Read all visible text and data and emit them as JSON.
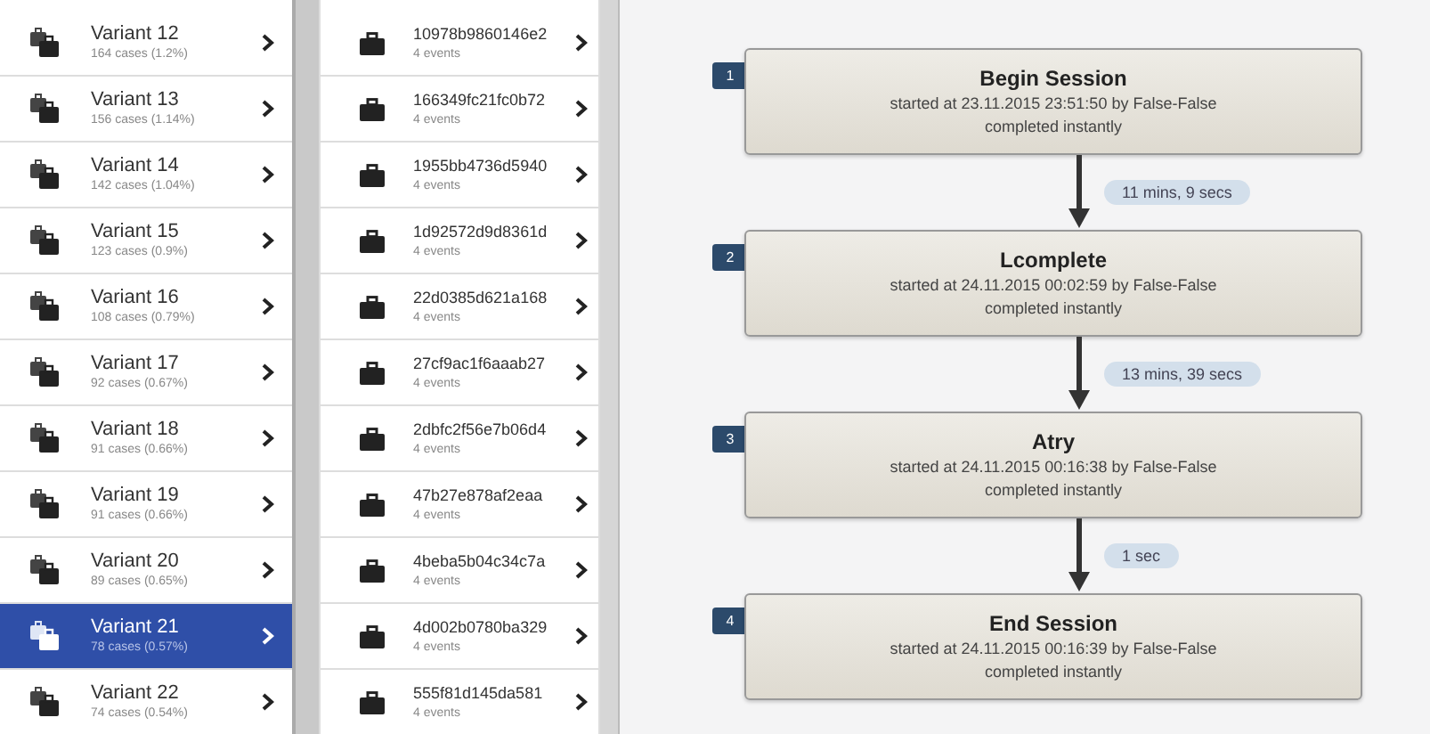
{
  "variants": [
    {
      "name": "Variant 12",
      "cases": "164 cases (1.2%)",
      "selected": false
    },
    {
      "name": "Variant 13",
      "cases": "156 cases (1.14%)",
      "selected": false
    },
    {
      "name": "Variant 14",
      "cases": "142 cases (1.04%)",
      "selected": false
    },
    {
      "name": "Variant 15",
      "cases": "123 cases (0.9%)",
      "selected": false
    },
    {
      "name": "Variant 16",
      "cases": "108 cases (0.79%)",
      "selected": false
    },
    {
      "name": "Variant 17",
      "cases": "92 cases (0.67%)",
      "selected": false
    },
    {
      "name": "Variant 18",
      "cases": "91 cases (0.66%)",
      "selected": false
    },
    {
      "name": "Variant 19",
      "cases": "91 cases (0.66%)",
      "selected": false
    },
    {
      "name": "Variant 20",
      "cases": "89 cases (0.65%)",
      "selected": false
    },
    {
      "name": "Variant 21",
      "cases": "78 cases (0.57%)",
      "selected": true
    },
    {
      "name": "Variant 22",
      "cases": "74 cases (0.54%)",
      "selected": false
    }
  ],
  "cases": [
    {
      "id": "10978b9860146e2",
      "events": "4 events"
    },
    {
      "id": "166349fc21fc0b72",
      "events": "4 events"
    },
    {
      "id": "1955bb4736d5940",
      "events": "4 events"
    },
    {
      "id": "1d92572d9d8361d",
      "events": "4 events"
    },
    {
      "id": "22d0385d621a168",
      "events": "4 events"
    },
    {
      "id": "27cf9ac1f6aaab27",
      "events": "4 events"
    },
    {
      "id": "2dbfc2f56e7b06d4",
      "events": "4 events"
    },
    {
      "id": "47b27e878af2eaa",
      "events": "4 events"
    },
    {
      "id": "4beba5b04c34c7a",
      "events": "4 events"
    },
    {
      "id": "4d002b0780ba329",
      "events": "4 events"
    },
    {
      "id": "555f81d145da581",
      "events": "4 events"
    }
  ],
  "steps": [
    {
      "number": "1",
      "title": "Begin Session",
      "started": "started at 23.11.2015 23:51:50 by False-False",
      "completed": "completed instantly",
      "duration": "11 mins, 9 secs"
    },
    {
      "number": "2",
      "title": "Lcomplete",
      "started": "started at 24.11.2015 00:02:59 by False-False",
      "completed": "completed instantly",
      "duration": "13 mins, 39 secs"
    },
    {
      "number": "3",
      "title": "Atry",
      "started": "started at 24.11.2015 00:16:38 by False-False",
      "completed": "completed instantly",
      "duration": "1 sec"
    },
    {
      "number": "4",
      "title": "End Session",
      "started": "started at 24.11.2015 00:16:39 by False-False",
      "completed": "completed instantly"
    }
  ]
}
